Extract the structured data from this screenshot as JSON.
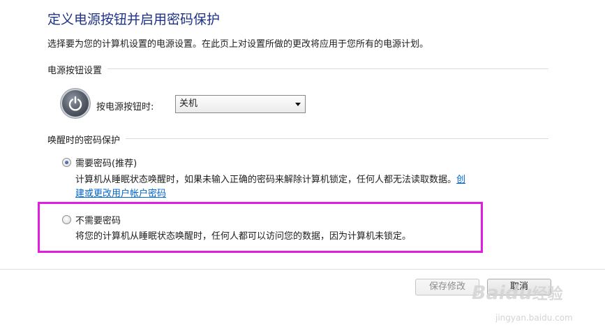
{
  "header": {
    "title": "定义电源按钮并启用密码保护",
    "description": "选择要为您的计算机设置的电源设置。在此页上对设置所做的更改将应用于您所有的电源计划。"
  },
  "power_section": {
    "heading": "电源按钮设置",
    "icon": "power-icon",
    "label": "按电源按钮时:",
    "selected_value": "关机"
  },
  "wake_section": {
    "heading": "唤醒时的密码保护",
    "options": [
      {
        "label": "需要密码(推荐)",
        "checked": true,
        "description_line1": "计算机从睡眠状态唤醒时，如果未输入正确的密码来解除计算机锁定，任何人都无法读取数据。",
        "link_part1": "创",
        "link_part2": "建或更改用户帐户密码"
      },
      {
        "label": "不需要密码",
        "checked": false,
        "description": "将您的计算机从睡眠状态唤醒时，任何人都可以访问您的数据，因为计算机未锁定。"
      }
    ]
  },
  "footer": {
    "save_label": "保存修改",
    "cancel_label": "取消"
  },
  "watermark": {
    "brand": "Baidu",
    "brand_suffix": "经验",
    "url": "jingyan.baidu.com"
  },
  "colors": {
    "title": "#1e3287",
    "link": "#0066cc",
    "highlight": "#e01ee0"
  }
}
